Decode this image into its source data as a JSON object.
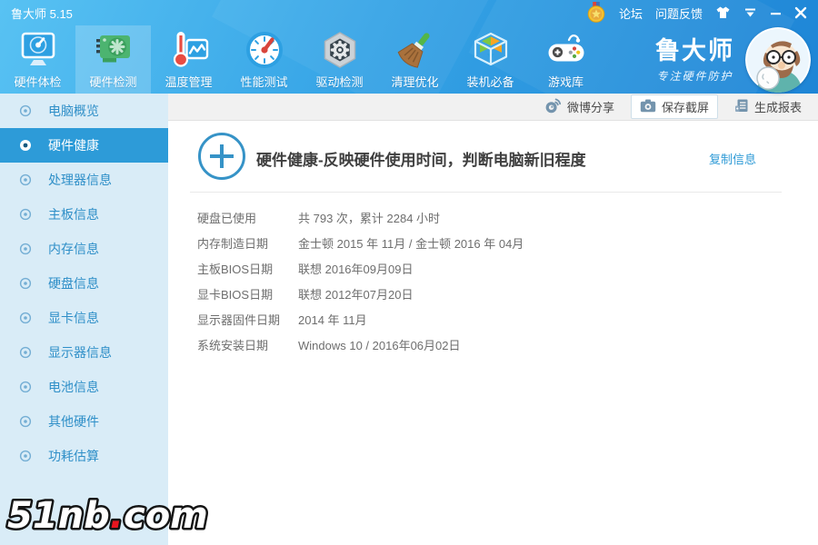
{
  "window": {
    "title": "鲁大师 5.15"
  },
  "titlebar": {
    "forum": "论坛",
    "feedback": "问题反馈",
    "icons": [
      "medal-icon",
      "skin-icon",
      "menu-chevron-icon",
      "minimize-icon",
      "close-icon"
    ]
  },
  "nav": {
    "items": [
      {
        "label": "硬件体检",
        "icon": "monitor-checkup-icon",
        "active": false
      },
      {
        "label": "硬件检测",
        "icon": "gpu-card-icon",
        "active": true
      },
      {
        "label": "温度管理",
        "icon": "thermometer-icon",
        "active": false
      },
      {
        "label": "性能测试",
        "icon": "speedometer-icon",
        "active": false
      },
      {
        "label": "驱动检测",
        "icon": "driver-nut-icon",
        "active": false
      },
      {
        "label": "清理优化",
        "icon": "broom-icon",
        "active": false
      },
      {
        "label": "装机必备",
        "icon": "cube-icon",
        "active": false
      },
      {
        "label": "游戏库",
        "icon": "gamepad-icon",
        "active": false
      }
    ]
  },
  "brand": {
    "logo": "鲁大师",
    "slogan": "专注硬件防护",
    "avatar": "mascot-avatar"
  },
  "toolbar": {
    "weibo": "微博分享",
    "screenshot": "保存截屏",
    "report": "生成报表"
  },
  "sidebar": {
    "items": [
      {
        "label": "电脑概览",
        "active": false
      },
      {
        "label": "硬件健康",
        "active": true
      },
      {
        "label": "处理器信息",
        "active": false
      },
      {
        "label": "主板信息",
        "active": false
      },
      {
        "label": "内存信息",
        "active": false
      },
      {
        "label": "硬盘信息",
        "active": false
      },
      {
        "label": "显卡信息",
        "active": false
      },
      {
        "label": "显示器信息",
        "active": false
      },
      {
        "label": "电池信息",
        "active": false
      },
      {
        "label": "其他硬件",
        "active": false
      },
      {
        "label": "功耗估算",
        "active": false
      }
    ]
  },
  "main": {
    "title": "硬件健康-反映硬件使用时间，判断电脑新旧程度",
    "copy_link": "复制信息",
    "rows": [
      {
        "label": "硬盘已使用",
        "value": "共 793 次，累计 2284 小时"
      },
      {
        "label": "内存制造日期",
        "value": "金士顿 2015 年 11月 / 金士顿 2016 年 04月"
      },
      {
        "label": "主板BIOS日期",
        "value": "联想 2016年09月09日"
      },
      {
        "label": "显卡BIOS日期",
        "value": "联想 2012年07月20日"
      },
      {
        "label": "显示器固件日期",
        "value": "2014 年 11月"
      },
      {
        "label": "系统安装日期",
        "value": "Windows 10 / 2016年06月02日"
      }
    ]
  },
  "watermark": {
    "part1": "51nb",
    "dot": ".",
    "part2": "com"
  },
  "colors": {
    "header_gradient_start": "#58c2f3",
    "header_gradient_end": "#1e85d6",
    "sidebar_bg": "#d9ecf7",
    "sidebar_active_bg": "#2d9bd8",
    "sidebar_text": "#2f8fc8",
    "toolbar_bg": "#f1f1f1",
    "accent_link": "#2e9ad6",
    "body_text": "#6e6e6e"
  }
}
